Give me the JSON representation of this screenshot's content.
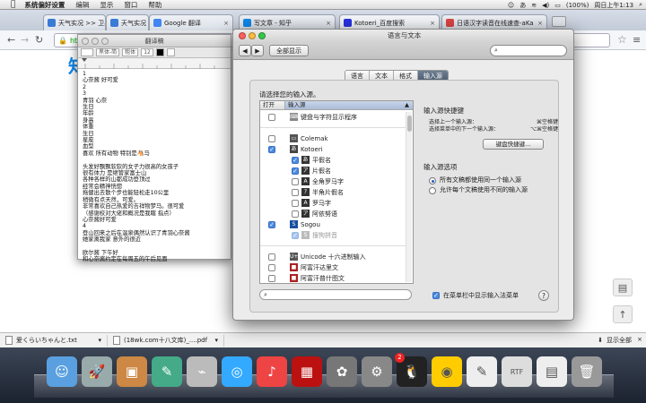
{
  "menubar": {
    "apple": "",
    "app": "系统偏好设置",
    "items": [
      "编辑",
      "显示",
      "窗口",
      "帮助"
    ],
    "battery": "(100%)",
    "clock": "周日上午1:13"
  },
  "browser": {
    "tabs": [
      {
        "label": "天气实况 >> 卫星云图 >> 日",
        "color": "#3a7bd5"
      },
      {
        "label": "天气实况 >> 卫星云图 >> 日",
        "color": "#3a7bd5"
      },
      {
        "label": "Google 翻译",
        "color": "#4285f4"
      },
      {
        "label": "写文章 - 知乎",
        "color": "#0f88eb"
      },
      {
        "label": "Kotoeri_百度搜索",
        "color": "#2932e1"
      },
      {
        "label": "日语汉字读音在线速查-aKa",
        "color": "#d44"
      }
    ],
    "url": "https",
    "page_heading": "知",
    "bookmark_star": "☆"
  },
  "textedit": {
    "title": "翻译稿",
    "font_family": "黑体-简",
    "font_style": "粗体",
    "font_size": "12",
    "body_lines": [
      "1",
      "心奈酱 好可爱",
      "2",
      "3",
      "青羽 心奈",
      "生日",
      "年龄",
      "身高",
      "体重",
      "生日",
      "星座",
      "血型",
      "喜欢 所有动物 特别是🐴马",
      "",
      "头发好飘飘软软的女子力很高的女孩子",
      "很有体力 是继管家富士山",
      "各种各样的山都成功登顶过",
      "经常会精神恍惚",
      "拖健出去散个步也能轻松走10公里",
      "稍微有点天然，可爱。",
      "非常喜欢自己热爱的吉祥物梦马。很可爱",
      "（感谢校对大佬和概况是我瞎 指点）",
      "心奈酱好可爱",
      "4",
      "登山回来之后在温泉偶然认识了青羽心奈酱",
      "她家离我家 意外的很近",
      "",
      "欧尔酱 下午好",
      "和心奈酱约定在每周五的午后见面"
    ]
  },
  "prefs": {
    "window_title": "语言与文本",
    "show_all": "全部显示",
    "search_value": "",
    "tabs": [
      "语言",
      "文本",
      "格式",
      "输入源"
    ],
    "active_tab": 3,
    "instruction": "请选择您的输入源。",
    "col_on": "打开",
    "col_source": "输入源",
    "sources": [
      {
        "label": "键盘与字符显示程序",
        "checked": false,
        "icon": "keyboard-viewer-icon"
      },
      {
        "label": "",
        "checked": false,
        "icon": ""
      },
      {
        "label": "Colemak",
        "checked": false,
        "icon": "keyboard-icon"
      },
      {
        "label": "Kotoeri",
        "checked": true,
        "icon": "kotoeri-icon"
      },
      {
        "label": "平假名",
        "checked": true,
        "icon": "hiragana-icon",
        "indent": true
      },
      {
        "label": "片假名",
        "checked": true,
        "icon": "katakana-icon",
        "indent": true
      },
      {
        "label": "全角罗马字",
        "checked": false,
        "icon": "fullwidth-romaji-icon",
        "indent": true
      },
      {
        "label": "半角片假名",
        "checked": false,
        "icon": "halfwidth-katakana-icon",
        "indent": true
      },
      {
        "label": "罗马字",
        "checked": false,
        "icon": "romaji-icon",
        "indent": true
      },
      {
        "label": "阿依努语",
        "checked": false,
        "icon": "ainu-icon",
        "indent": true
      },
      {
        "label": "Sogou",
        "checked": true,
        "icon": "sogou-icon"
      },
      {
        "label": "搜狗拼音",
        "checked": true,
        "icon": "sogou-pinyin-icon",
        "indent": true,
        "disabled": true
      },
      {
        "label": "",
        "checked": false,
        "icon": ""
      },
      {
        "label": "Unicode 十六进制输入",
        "checked": false,
        "icon": "unicode-icon"
      },
      {
        "label": "阿富汗达里文",
        "checked": false,
        "icon": "flag-icon"
      },
      {
        "label": "阿富汗普什图文",
        "checked": false,
        "icon": "flag-icon"
      }
    ],
    "shortcuts_heading": "输入源快捷键",
    "shortcuts": [
      {
        "label": "选择上一个输入源：",
        "key": "⌘空格键"
      },
      {
        "label": "选择菜单中的下一个输入源：",
        "key": "⌥⌘空格键"
      }
    ],
    "kb_button": "键盘快捷键...",
    "options_heading": "输入源选项",
    "options": [
      {
        "label": "所有文稿都使用同一个输入源",
        "selected": true
      },
      {
        "label": "允许每个文稿使用不同的输入源",
        "selected": false
      }
    ],
    "list_search_placeholder": "",
    "show_in_menu_label": "在菜单栏中显示输入法菜单",
    "show_in_menu_checked": true,
    "help": "?"
  },
  "downloads": {
    "items": [
      "爱くらいちゃんと.txt",
      "(18wk.com十八文库)_....pdf"
    ],
    "show_all": "显示全部"
  },
  "dock": [
    "finder-icon",
    "launchpad-icon",
    "photo-icon",
    "preview-icon",
    "satellite-icon",
    "safari-icon",
    "itunes-icon",
    "photobooth-icon",
    "photos-icon",
    "system-preferences-icon",
    "qq-icon",
    "chrome-icon",
    "textedit-icon",
    "rtf-document-icon",
    "document-icon",
    "trash-icon"
  ],
  "dock_badge": "2"
}
